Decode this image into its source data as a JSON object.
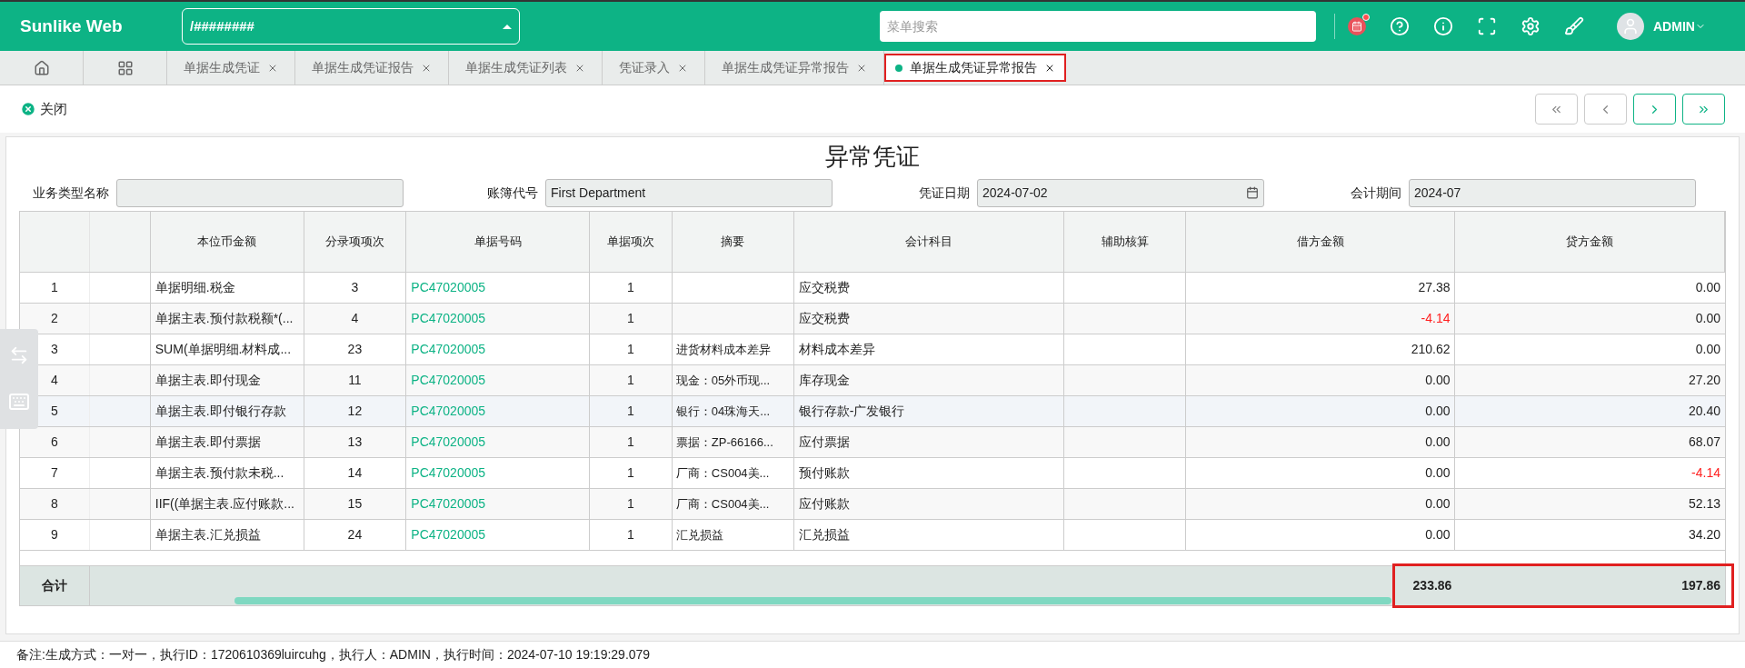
{
  "header": {
    "logo": "Sunlike Web",
    "path_select": "/########",
    "menu_search": {
      "placeholder": "菜单搜索"
    },
    "user": "ADMIN"
  },
  "tabs": [
    {
      "label": "单据生成凭证",
      "selected": false
    },
    {
      "label": "单据生成凭证报告",
      "selected": false
    },
    {
      "label": "单据生成凭证列表",
      "selected": false
    },
    {
      "label": "凭证录入",
      "selected": false
    },
    {
      "label": "单据生成凭证异常报告",
      "selected": false
    },
    {
      "label": "单据生成凭证异常报告",
      "selected": true
    }
  ],
  "toolbar": {
    "close": "关闭"
  },
  "report": {
    "title": "异常凭证",
    "fields": [
      {
        "label": "业务类型名称",
        "kind": "text"
      },
      {
        "label": "账簿代号",
        "value": "First Department",
        "kind": "text"
      },
      {
        "label": "凭证日期",
        "value": "2024-07-02",
        "kind": "date"
      },
      {
        "label": "会计期间",
        "value": "2024-07",
        "kind": "text"
      }
    ],
    "table": {
      "columns": [
        "本位币金额",
        "分录项项次",
        "单据号码",
        "单据项次",
        "摘要",
        "会计科目",
        "辅助核算",
        "借方金额",
        "贷方金额"
      ],
      "rows": [
        {
          "no": "1",
          "expr": "单据明细.税金",
          "entry": "3",
          "doc": "PC47020005",
          "item": "1",
          "summary": "",
          "account": "应交税费",
          "aux": "",
          "debit": "27.38",
          "debit_negative": false,
          "credit": "0.00",
          "credit_negative": false
        },
        {
          "no": "2",
          "expr": "单据主表.预付款税额*(...",
          "entry": "4",
          "doc": "PC47020005",
          "item": "1",
          "summary": "",
          "account": "应交税费",
          "aux": "",
          "debit": "-4.14",
          "debit_negative": true,
          "credit": "0.00",
          "credit_negative": false
        },
        {
          "no": "3",
          "expr": "SUM(单据明细.材料成...",
          "entry": "23",
          "doc": "PC47020005",
          "item": "1",
          "summary": "进货材料成本差异",
          "account": "材料成本差异",
          "aux": "",
          "debit": "210.62",
          "debit_negative": false,
          "credit": "0.00",
          "credit_negative": false
        },
        {
          "no": "4",
          "expr": "单据主表.即付现金",
          "entry": "11",
          "doc": "PC47020005",
          "item": "1",
          "summary": "现金：05外币现...",
          "account": "库存现金",
          "aux": "",
          "debit": "0.00",
          "debit_negative": false,
          "credit": "27.20",
          "credit_negative": false
        },
        {
          "no": "5",
          "expr": "单据主表.即付银行存款",
          "entry": "12",
          "doc": "PC47020005",
          "item": "1",
          "summary": "银行：04珠海天...",
          "account": "银行存款-广发银行",
          "aux": "",
          "debit": "0.00",
          "debit_negative": false,
          "credit": "20.40",
          "credit_negative": false
        },
        {
          "no": "6",
          "expr": "单据主表.即付票据",
          "entry": "13",
          "doc": "PC47020005",
          "item": "1",
          "summary": "票据：ZP-66166...",
          "account": "应付票据",
          "aux": "",
          "debit": "0.00",
          "debit_negative": false,
          "credit": "68.07",
          "credit_negative": false
        },
        {
          "no": "7",
          "expr": "单据主表.预付款未税...",
          "entry": "14",
          "doc": "PC47020005",
          "item": "1",
          "summary": "厂商：CS004美...",
          "account": "预付账款",
          "aux": "",
          "debit": "0.00",
          "debit_negative": false,
          "credit": "-4.14",
          "credit_negative": true
        },
        {
          "no": "8",
          "expr": "IIF((单据主表.应付账款...",
          "entry": "15",
          "doc": "PC47020005",
          "item": "1",
          "summary": "厂商：CS004美...",
          "account": "应付账款",
          "aux": "",
          "debit": "0.00",
          "debit_negative": false,
          "credit": "52.13",
          "credit_negative": false
        },
        {
          "no": "9",
          "expr": "单据主表.汇兑损益",
          "entry": "24",
          "doc": "PC47020005",
          "item": "1",
          "summary": "汇兑损益",
          "account": "汇兑损益",
          "aux": "",
          "debit": "0.00",
          "debit_negative": false,
          "credit": "34.20",
          "credit_negative": false
        }
      ],
      "total": {
        "label": "合计",
        "debit": "233.86",
        "credit": "197.86"
      }
    }
  },
  "footer": {
    "note": "备注:生成方式：一对一，执行ID：1720610369luircuhg，执行人：ADMIN，执行时间：2024-07-10 19:19:29.079"
  }
}
